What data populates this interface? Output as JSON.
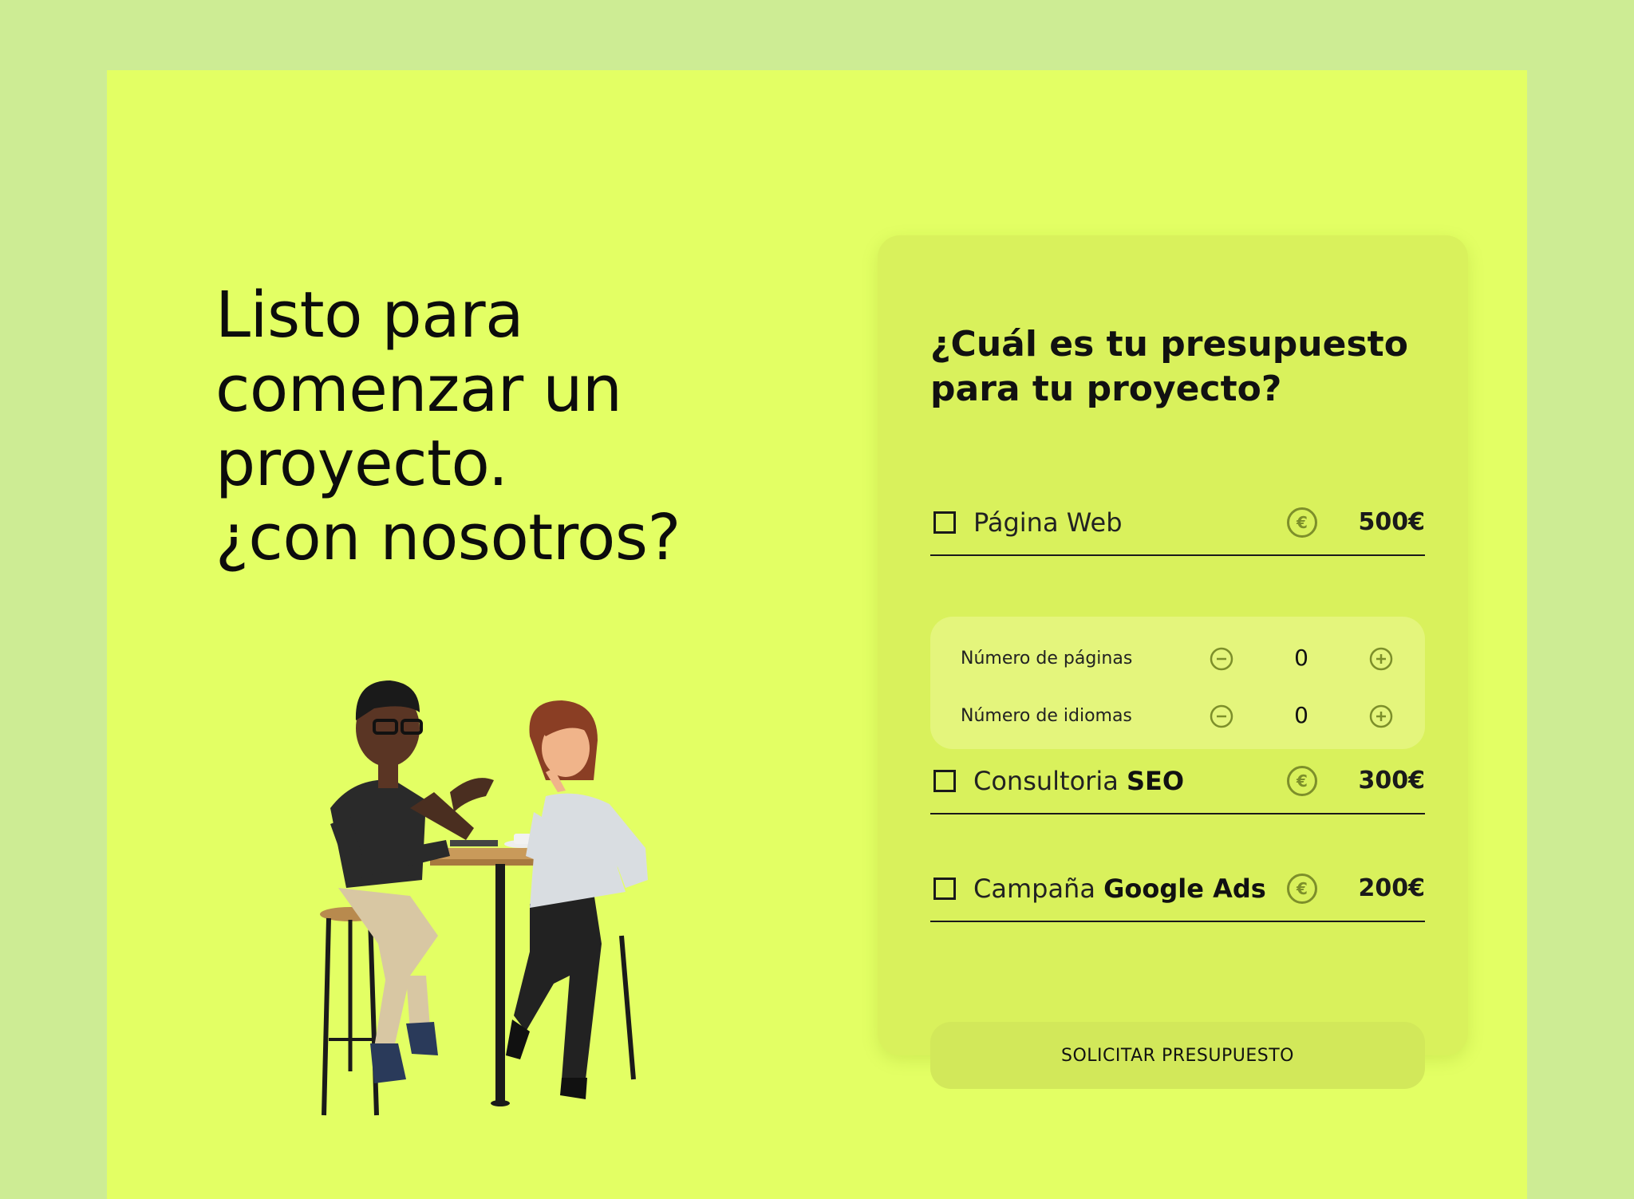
{
  "hero": {
    "line1": "Listo para",
    "line2": "comenzar un",
    "line3": "proyecto.",
    "line4": "¿con nosotros?"
  },
  "illustration": {
    "alt": "people-talking-at-table-illustration"
  },
  "form": {
    "title_line1": "¿Cuál es tu presupuesto",
    "title_line2": "para tu proyecto?",
    "options": [
      {
        "label": "Página Web",
        "label_bold": "",
        "price": "500€",
        "checked": false,
        "icon": "euro-icon"
      },
      {
        "label": "Consultoria ",
        "label_bold": "SEO",
        "price": "300€",
        "checked": false,
        "icon": "euro-icon"
      },
      {
        "label": "Campaña ",
        "label_bold": "Google Ads",
        "price": "200€",
        "checked": false,
        "icon": "euro-icon"
      }
    ],
    "web_details": {
      "pages_label": "Número de páginas",
      "pages_value": "0",
      "languages_label": "Número de idiomas",
      "languages_value": "0"
    },
    "submit_label": "SOLICITAR PRESUPUESTO"
  },
  "colors": {
    "page_bg": "#cdec94",
    "frame_bg": "#e3ff64",
    "card_bg": "#d9f15c",
    "subpanel_bg": "#e4f57c",
    "icon_olive": "#7d8f2a"
  }
}
